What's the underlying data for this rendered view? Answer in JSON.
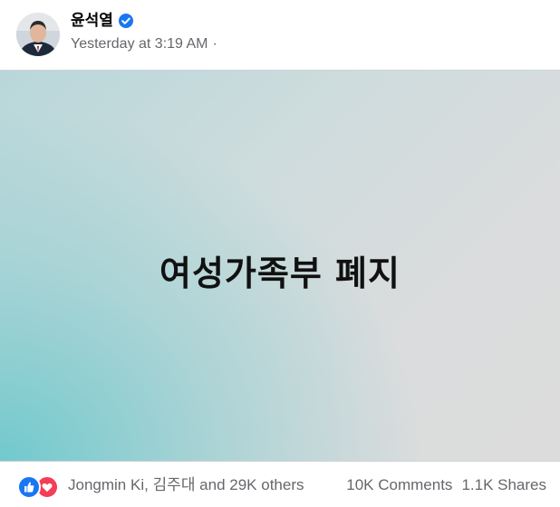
{
  "post": {
    "author": "윤석열",
    "verified_icon": "verified-badge-icon",
    "timestamp": "Yesterday at 3:19 AM",
    "separator": "·",
    "audience_icon": "",
    "image_text": "여성가족부 폐지"
  },
  "footer": {
    "reaction_icons": [
      "like-reaction-icon",
      "love-reaction-icon"
    ],
    "reactors": "Jongmin Ki, 김주대 and 29K others",
    "comments": "10K Comments",
    "shares": "1.1K Shares"
  },
  "colors": {
    "verified": "#1877f2",
    "like": "#1877f2",
    "love": "#f33e58",
    "meta_text": "#65676b"
  }
}
